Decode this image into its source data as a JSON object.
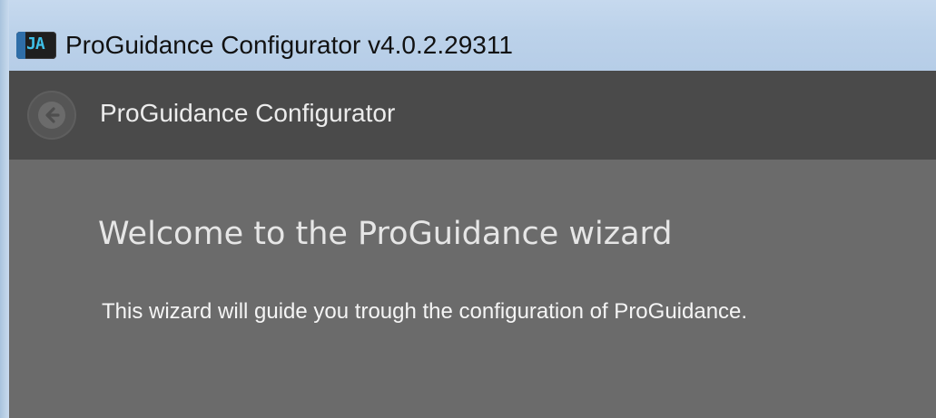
{
  "window": {
    "title": "ProGuidance Configurator v4.0.2.29311",
    "icon": "app-logo-icon"
  },
  "header": {
    "back_icon": "back-arrow-icon",
    "title": "ProGuidance Configurator"
  },
  "content": {
    "heading": "Welcome to the ProGuidance wizard",
    "description": "This wizard will guide you trough the configuration of ProGuidance."
  },
  "colors": {
    "titlebar": "#bcd2ea",
    "header_bg": "#4a4a4a",
    "content_bg": "#6b6b6b",
    "text_light": "#e6e6e6"
  }
}
